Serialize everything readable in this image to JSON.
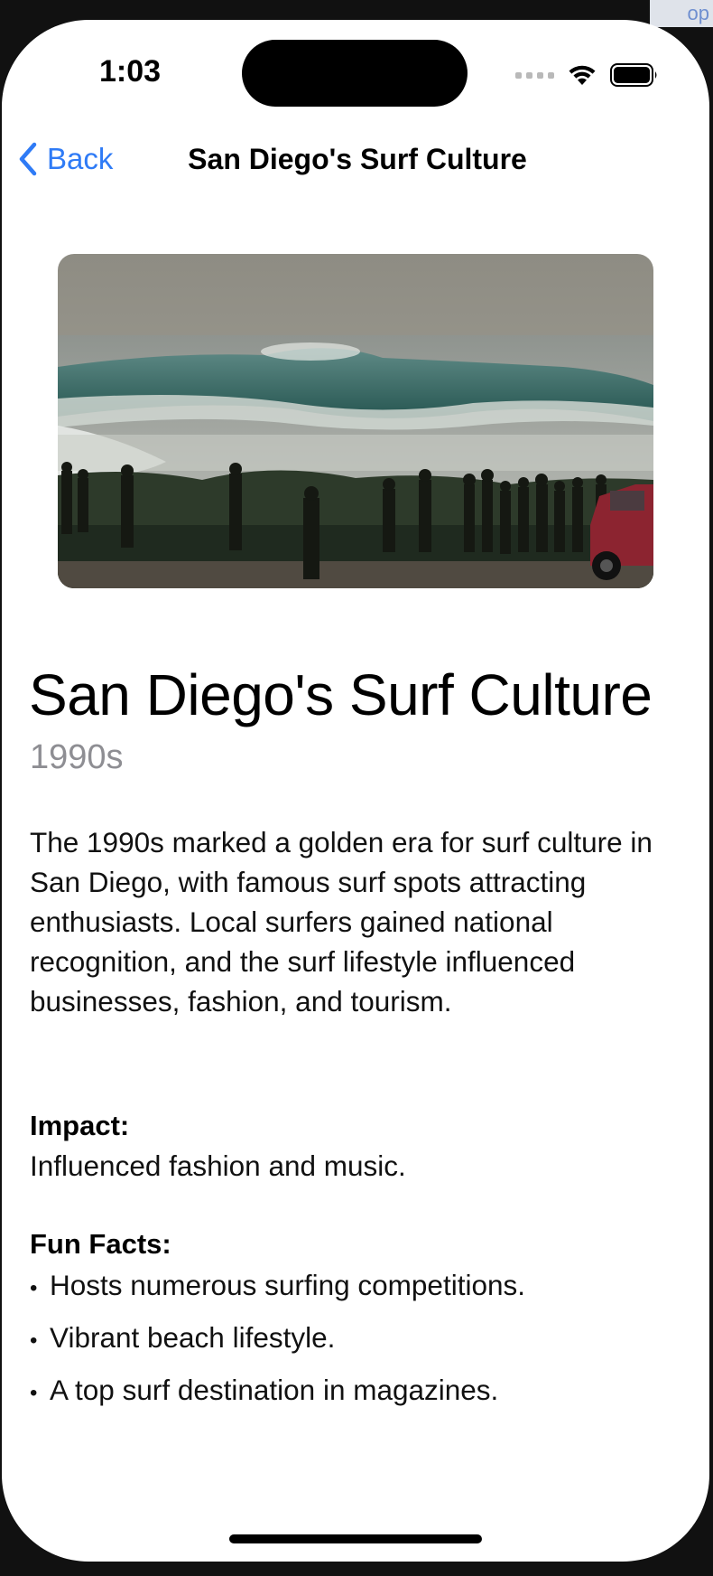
{
  "corner_hint": "op",
  "status_bar": {
    "time": "1:03",
    "icons": [
      "cellular-dots-icon",
      "wifi-icon",
      "battery-icon"
    ]
  },
  "nav": {
    "back_label": "Back",
    "back_icon": "chevron-left-icon",
    "title": "San Diego's Surf Culture"
  },
  "hero_image": {
    "subject": "surf-wave-photo"
  },
  "content": {
    "title": "San Diego's Surf Culture",
    "era": "1990s",
    "description": "The 1990s marked a golden era for surf culture in San Diego, with famous surf spots attracting enthusiasts. Local surfers gained national recognition, and the surf lifestyle influenced businesses, fashion, and tourism.",
    "impact_label": "Impact:",
    "impact_text": "Influenced fashion and music.",
    "fun_facts_label": "Fun Facts:",
    "fun_facts": [
      "Hosts numerous surfing competitions.",
      "Vibrant beach lifestyle.",
      "A top surf destination in magazines."
    ]
  },
  "colors": {
    "accent": "#2f7bf6",
    "secondary_text": "#8e8e93",
    "background": "#ffffff"
  }
}
